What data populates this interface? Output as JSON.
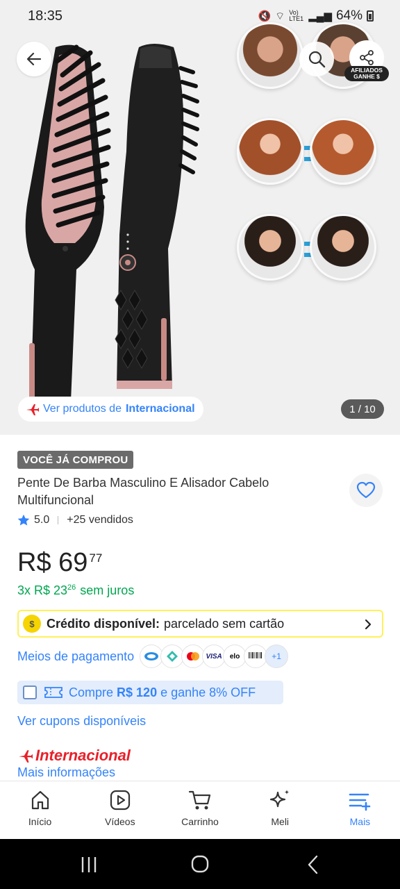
{
  "status_bar": {
    "time": "18:35",
    "network": "Vo) LTE1",
    "battery": "64%"
  },
  "gallery": {
    "counter": "1 / 10",
    "origin_prefix": "Ver produtos de",
    "origin_link": "Internacional",
    "affiliate_badge_line1": "AFILIADOS",
    "affiliate_badge_line2": "GANHE $"
  },
  "product": {
    "tag": "VOCÊ JÁ COMPROU",
    "title": "Pente De Barba Masculino E Alisador Cabelo Multifuncional",
    "rating": "5.0",
    "sold": "+25 vendidos",
    "price_main": "R$ 69",
    "price_cents": "77",
    "installments_prefix": "3x R$ 23",
    "installments_cents": "26",
    "installments_suffix": "sem juros"
  },
  "credit": {
    "bold": "Crédito disponível:",
    "text": "parcelado sem cartão"
  },
  "payments": {
    "link": "Meios de pagamento",
    "methods": [
      "Mercado Pago",
      "Pix",
      "Mastercard",
      "VISA",
      "elo",
      "Boleto"
    ],
    "more": "+1"
  },
  "coupon": {
    "prefix": "Compre",
    "amount": "R$ 120",
    "suffix": "e ganhe 8% OFF",
    "link": "Ver cupons disponíveis"
  },
  "seller": {
    "brand": "Internacional",
    "more_info": "Mais informações"
  },
  "bottom_nav": [
    {
      "label": "Início",
      "icon": "home-icon"
    },
    {
      "label": "Vídeos",
      "icon": "play-icon"
    },
    {
      "label": "Carrinho",
      "icon": "cart-icon"
    },
    {
      "label": "Meli",
      "icon": "sparkle-icon"
    },
    {
      "label": "Mais",
      "icon": "menu-plus-icon",
      "active": true
    }
  ],
  "colors": {
    "accent": "#3483fa",
    "green": "#00a650",
    "brand_red": "#e8202a",
    "credit_yellow": "#fff159"
  }
}
